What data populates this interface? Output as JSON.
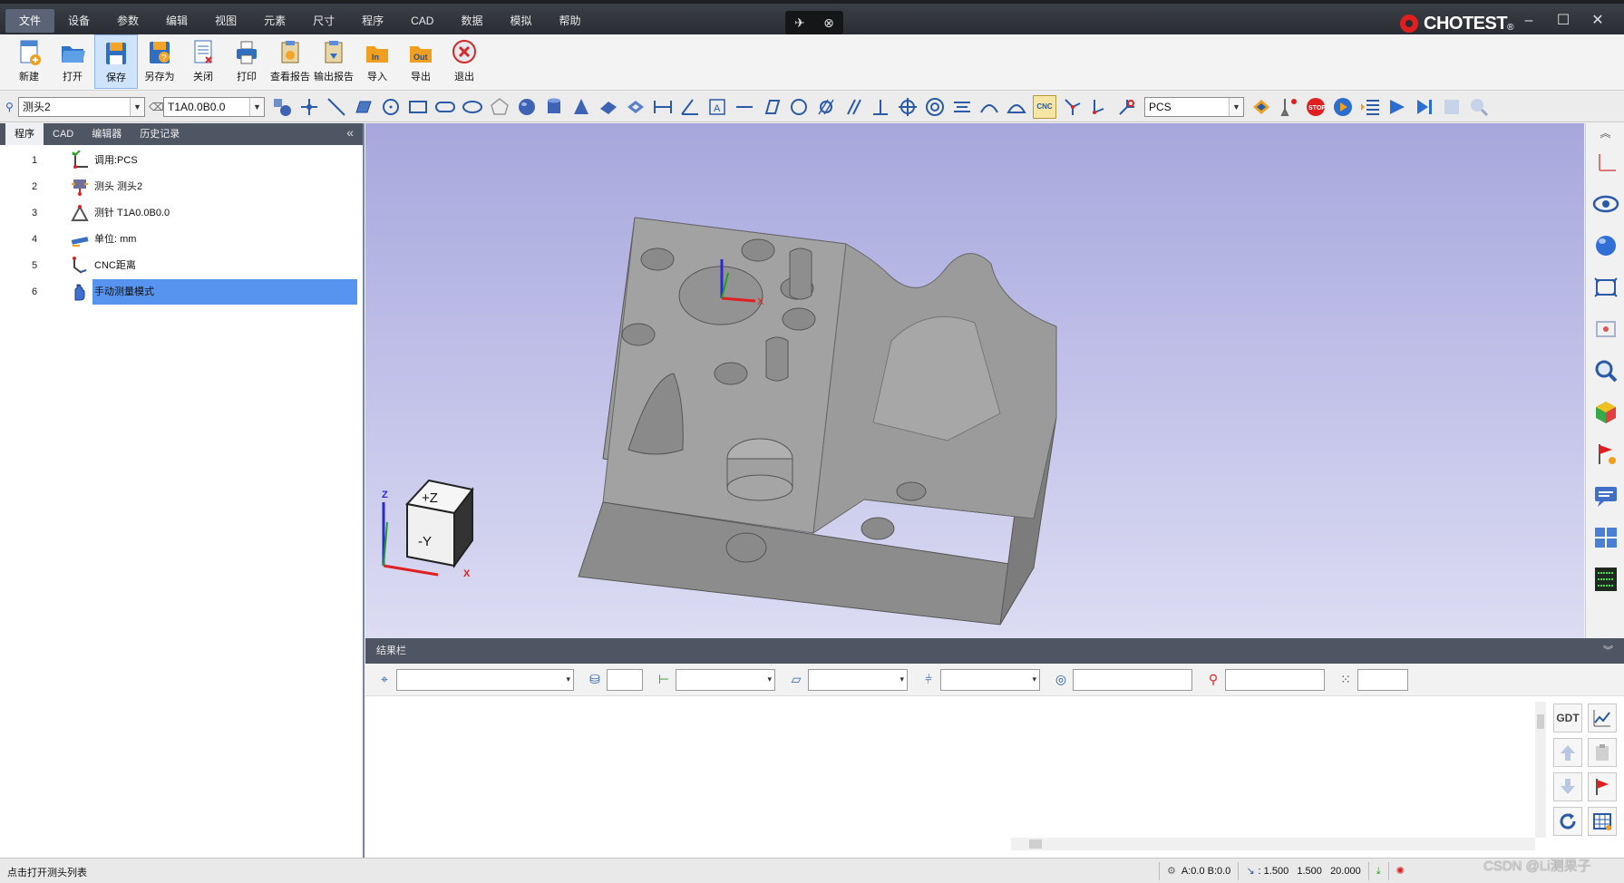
{
  "menu": {
    "items": [
      "文件",
      "设备",
      "参数",
      "编辑",
      "视图",
      "元素",
      "尺寸",
      "程序",
      "CAD",
      "数据",
      "模拟",
      "帮助"
    ],
    "active_index": 0
  },
  "window": {
    "brand": "CHOTEST",
    "brand_mark": "®"
  },
  "ribbon": {
    "buttons": [
      {
        "label": "新建",
        "icon": "new-file-icon"
      },
      {
        "label": "打开",
        "icon": "open-folder-icon"
      },
      {
        "label": "保存",
        "icon": "save-icon",
        "selected": true
      },
      {
        "label": "另存为",
        "icon": "save-as-icon"
      },
      {
        "label": "关闭",
        "icon": "close-file-icon"
      },
      {
        "label": "打印",
        "icon": "print-icon"
      },
      {
        "label": "查看报告",
        "icon": "view-report-icon"
      },
      {
        "label": "输出报告",
        "icon": "export-report-icon"
      },
      {
        "label": "导入",
        "icon": "import-icon"
      },
      {
        "label": "导出",
        "icon": "export-icon"
      },
      {
        "label": "退出",
        "icon": "exit-icon"
      }
    ]
  },
  "toolbar": {
    "probe_combo": "测头2",
    "tip_combo": "T1A0.0B0.0",
    "coord_combo": "PCS",
    "cnc_label": "CNC"
  },
  "left_panel": {
    "tabs": [
      "程序",
      "CAD",
      "编辑器",
      "历史记录"
    ],
    "active_tab": 0,
    "rows": [
      {
        "num": "1",
        "label": "调用:PCS",
        "icon": "coordinate-call-icon"
      },
      {
        "num": "2",
        "label": "测头 测头2",
        "icon": "probe-head-icon"
      },
      {
        "num": "3",
        "label": "测针 T1A0.0B0.0",
        "icon": "stylus-icon"
      },
      {
        "num": "4",
        "label": "单位: mm",
        "icon": "unit-ruler-icon"
      },
      {
        "num": "5",
        "label": "CNC距离",
        "icon": "cnc-distance-icon"
      },
      {
        "num": "6",
        "label": "手动测量模式",
        "icon": "hand-mode-icon",
        "selected": true
      }
    ]
  },
  "viewport": {
    "cube_top": "+Z",
    "cube_front": "-Y",
    "axis_z": "Z",
    "axis_x": "X",
    "part_axis_x": "X"
  },
  "results": {
    "title": "结果栏",
    "gdt_label": "GDT"
  },
  "status": {
    "text": "点击打开测头列表",
    "angles": "A:0.0  B:0.0",
    "v1": "1.500",
    "v2": "1.500",
    "v3": "20.000"
  },
  "watermark": "CSDN @Li测果子",
  "colors": {
    "title_bg": "#2a2d33",
    "panel_header": "#4e5563",
    "selection": "#5694ef",
    "viewport_top": "#a7a7dd",
    "brand_red": "#e02020"
  }
}
